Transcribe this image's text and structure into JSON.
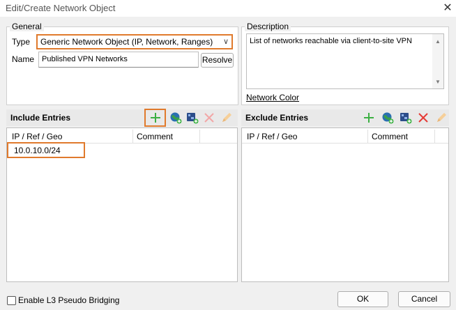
{
  "window": {
    "title": "Edit/Create Network Object"
  },
  "general": {
    "legend": "General",
    "type_label": "Type",
    "type_value": "Generic Network Object (IP, Network, Ranges)",
    "name_label": "Name",
    "name_value": "Published VPN Networks",
    "resolve_label": "Resolve"
  },
  "description": {
    "legend": "Description",
    "text": "List of networks reachable via client-to-site VPN",
    "network_color_link": "Network Color"
  },
  "include": {
    "title": "Include Entries",
    "col_ip": "IP / Ref / Geo",
    "col_comment": "Comment",
    "entries": [
      {
        "ip": "10.0.10.0/24",
        "comment": ""
      }
    ]
  },
  "exclude": {
    "title": "Exclude Entries",
    "col_ip": "IP / Ref / Geo",
    "col_comment": "Comment",
    "entries": []
  },
  "footer": {
    "bridging_label": "Enable L3 Pseudo Bridging",
    "bridging_checked": false,
    "ok_label": "OK",
    "cancel_label": "Cancel"
  },
  "colors": {
    "highlight": "#e07a2c",
    "add_green": "#3cb043",
    "delete_red": "#e53935",
    "edit_orange": "#f0a030"
  },
  "icons": [
    "close-icon",
    "chevron-down-icon",
    "plus-icon",
    "globe-icon",
    "add-object-icon",
    "delete-icon",
    "edit-icon",
    "scroll-up-icon",
    "scroll-down-icon"
  ]
}
